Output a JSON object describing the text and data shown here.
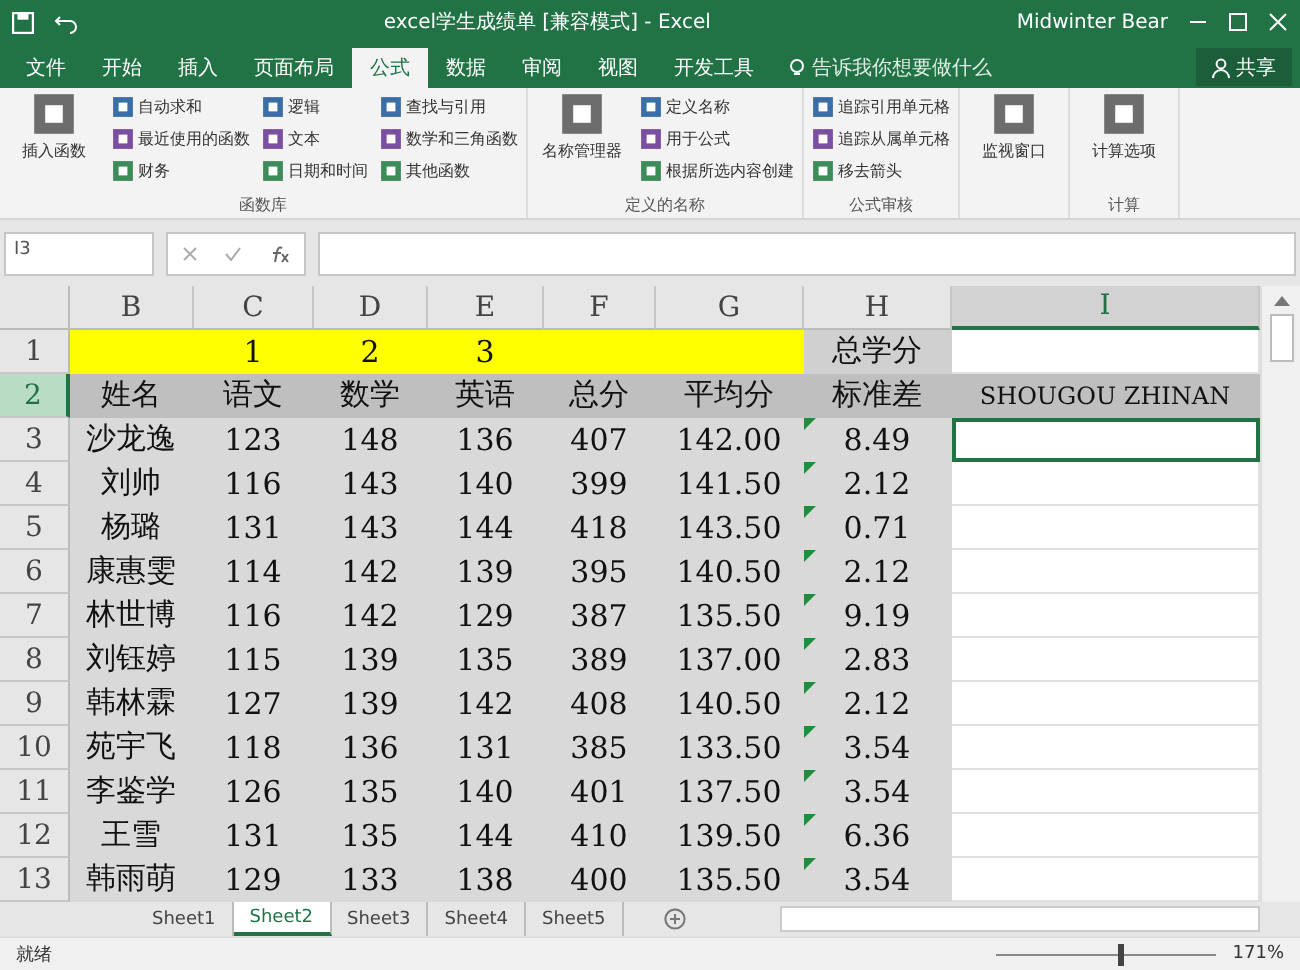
{
  "window": {
    "title": "excel学生成绩单  [兼容模式]  -  Excel",
    "user": "Midwinter Bear"
  },
  "tabs": [
    {
      "label": "文件",
      "selected": false
    },
    {
      "label": "开始",
      "selected": false
    },
    {
      "label": "插入",
      "selected": false
    },
    {
      "label": "页面布局",
      "selected": false
    },
    {
      "label": "公式",
      "selected": true
    },
    {
      "label": "数据",
      "selected": false
    },
    {
      "label": "审阅",
      "selected": false
    },
    {
      "label": "视图",
      "selected": false
    },
    {
      "label": "开发工具",
      "selected": false
    }
  ],
  "tell_me": {
    "placeholder": "告诉我你想要做什么"
  },
  "share_button": "共享",
  "ribbon_groups": [
    {
      "label": "函数库",
      "big": [
        "插入函数"
      ],
      "columns": [
        [
          "自动求和",
          "最近使用的函数",
          "财务"
        ],
        [
          "逻辑",
          "文本",
          "日期和时间"
        ],
        [
          "查找与引用",
          "数学和三角函数",
          "其他函数"
        ]
      ]
    },
    {
      "label": "定义的名称",
      "big": [
        "名称管理器"
      ],
      "columns": [
        [
          "定义名称",
          "用于公式",
          "根据所选内容创建"
        ]
      ]
    },
    {
      "label": "公式审核",
      "columns": [
        [
          "追踪引用单元格",
          "追踪从属单元格",
          "移去箭头"
        ]
      ]
    },
    {
      "big": [
        "监视窗口"
      ]
    },
    {
      "label": "计算",
      "big": [
        "计算选项"
      ]
    }
  ],
  "name_box": "I3",
  "columns": [
    {
      "label": "B",
      "selected": false
    },
    {
      "label": "C",
      "selected": false
    },
    {
      "label": "D",
      "selected": false
    },
    {
      "label": "E",
      "selected": false
    },
    {
      "label": "F",
      "selected": false
    },
    {
      "label": "G",
      "selected": false
    },
    {
      "label": "H",
      "selected": false
    },
    {
      "label": "I",
      "selected": true
    }
  ],
  "rows": [
    {
      "number": "1",
      "selected": false,
      "kind": "title",
      "cells": [
        "",
        "1",
        "2",
        "3",
        "",
        "",
        "总学分",
        ""
      ]
    },
    {
      "number": "2",
      "selected": true,
      "kind": "header",
      "cells": [
        "姓名",
        "语文",
        "数学",
        "英语",
        "总分",
        "平均分",
        "标准差",
        "SHOUGOU ZHINAN"
      ]
    },
    {
      "number": "3",
      "selected": false,
      "kind": "data",
      "cursor": true,
      "cells": [
        "沙龙逸",
        "123",
        "148",
        "136",
        "407",
        "142.00",
        "8.49",
        ""
      ],
      "error_flag": true
    },
    {
      "number": "4",
      "selected": false,
      "kind": "data",
      "cells": [
        "刘帅",
        "116",
        "143",
        "140",
        "399",
        "141.50",
        "2.12",
        ""
      ],
      "error_flag": true
    },
    {
      "number": "5",
      "selected": false,
      "kind": "data",
      "cells": [
        "杨璐",
        "131",
        "143",
        "144",
        "418",
        "143.50",
        "0.71",
        ""
      ],
      "error_flag": true
    },
    {
      "number": "6",
      "selected": false,
      "kind": "data",
      "cells": [
        "康惠雯",
        "114",
        "142",
        "139",
        "395",
        "140.50",
        "2.12",
        ""
      ],
      "error_flag": true
    },
    {
      "number": "7",
      "selected": false,
      "kind": "data",
      "cells": [
        "林世博",
        "116",
        "142",
        "129",
        "387",
        "135.50",
        "9.19",
        ""
      ],
      "error_flag": true
    },
    {
      "number": "8",
      "selected": false,
      "kind": "data",
      "cells": [
        "刘钰婷",
        "115",
        "139",
        "135",
        "389",
        "137.00",
        "2.83",
        ""
      ],
      "error_flag": true
    },
    {
      "number": "9",
      "selected": false,
      "kind": "data",
      "cells": [
        "韩林霖",
        "127",
        "139",
        "142",
        "408",
        "140.50",
        "2.12",
        ""
      ],
      "error_flag": true
    },
    {
      "number": "10",
      "selected": false,
      "kind": "data",
      "cells": [
        "苑宇飞",
        "118",
        "136",
        "131",
        "385",
        "133.50",
        "3.54",
        ""
      ],
      "error_flag": true
    },
    {
      "number": "11",
      "selected": false,
      "kind": "data",
      "cells": [
        "李鉴学",
        "126",
        "135",
        "140",
        "401",
        "137.50",
        "3.54",
        ""
      ],
      "error_flag": true
    },
    {
      "number": "12",
      "selected": false,
      "kind": "data",
      "cells": [
        "王雪",
        "131",
        "135",
        "144",
        "410",
        "139.50",
        "6.36",
        ""
      ],
      "error_flag": true
    },
    {
      "number": "13",
      "selected": false,
      "kind": "data",
      "cells": [
        "韩雨萌",
        "129",
        "133",
        "138",
        "400",
        "135.50",
        "3.54",
        ""
      ],
      "error_flag": true
    }
  ],
  "sheets": [
    {
      "label": "Sheet1",
      "selected": false
    },
    {
      "label": "Sheet2",
      "selected": true
    },
    {
      "label": "Sheet3",
      "selected": false
    },
    {
      "label": "Sheet4",
      "selected": false
    },
    {
      "label": "Sheet5",
      "selected": false
    }
  ],
  "status_bar": {
    "status": "就绪",
    "zoom": "171%",
    "zoom_slider": {
      "level": 0.55
    }
  }
}
